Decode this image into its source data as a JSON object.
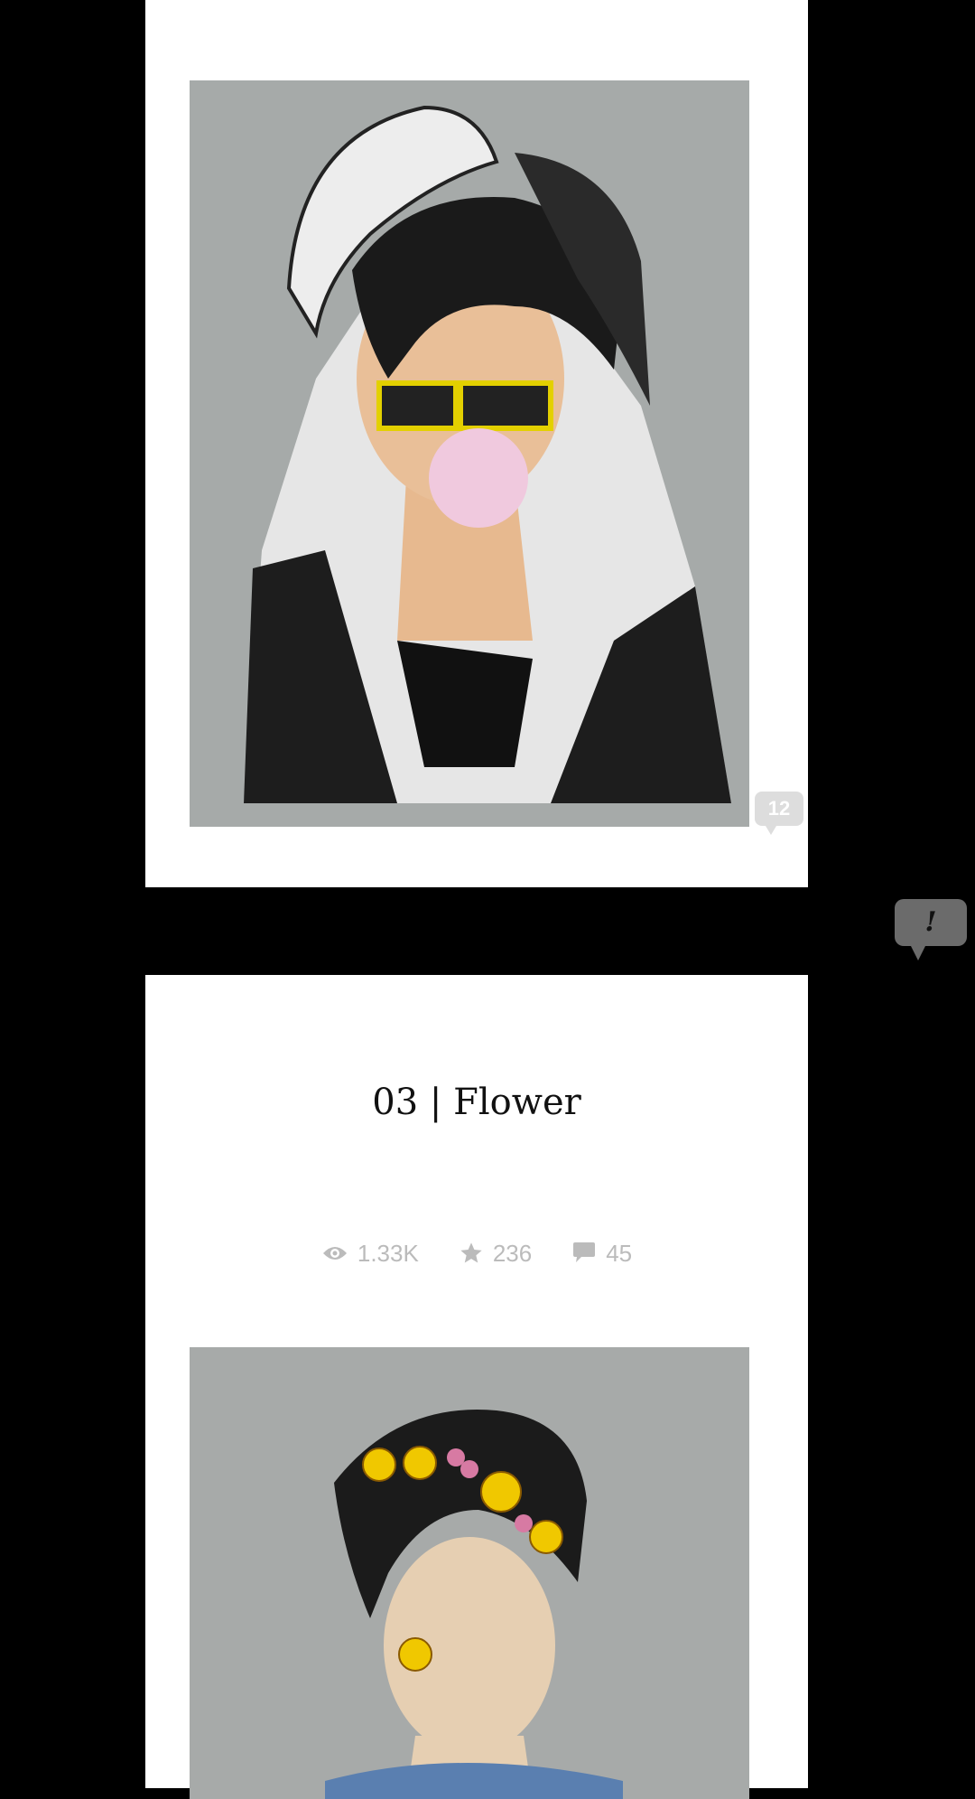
{
  "episodes": [
    {
      "title": "",
      "artwork": "drawing of a boy with cap, sunglasses and bubble gum",
      "comment_count": "12"
    },
    {
      "title": "03 | Flower",
      "views": "1.33K",
      "stars": "236",
      "comments": "45",
      "artwork": "drawing of a boy with flower crown"
    }
  ],
  "side_bubble": {
    "label": "!"
  },
  "icons": {
    "views": "eye-icon",
    "stars": "star-icon",
    "comments": "speech-bubble-icon"
  },
  "colors": {
    "background": "#000000",
    "card": "#ffffff",
    "stat_text": "#bbbbbb"
  }
}
